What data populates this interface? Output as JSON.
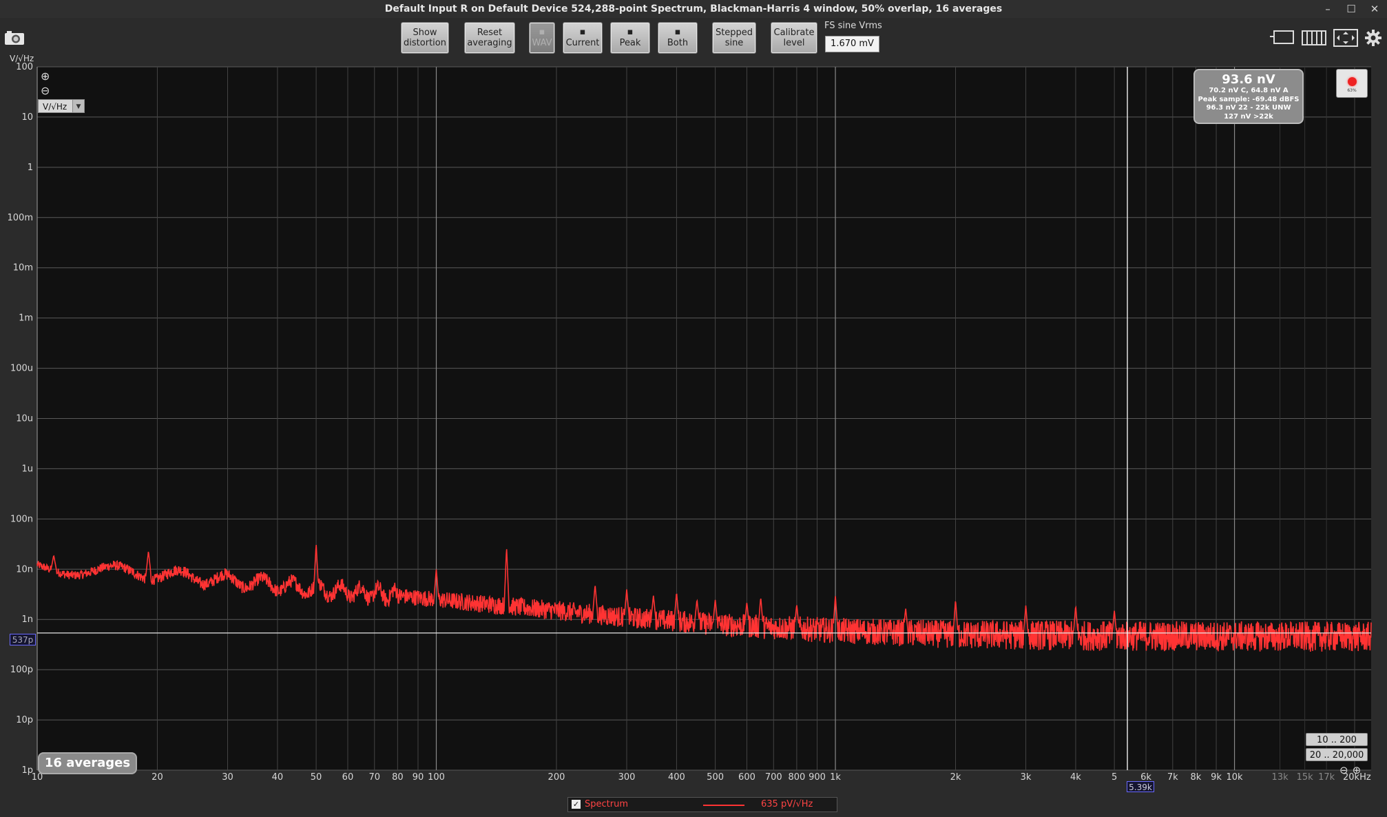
{
  "window": {
    "title": "Default Input R on Default Device 524,288-point Spectrum, Blackman-Harris 4 window, 50% overlap, 16 averages",
    "minimize": "–",
    "maximize": "☐",
    "close": "✕"
  },
  "toolbar": {
    "show_distortion": [
      "Show",
      "distortion"
    ],
    "reset_averaging": [
      "Reset",
      "averaging"
    ],
    "wav": "WAV",
    "current": "Current",
    "peak": "Peak",
    "both": "Both",
    "stepped_sine": [
      "Stepped",
      "sine"
    ],
    "calibrate_level": [
      "Calibrate",
      "level"
    ],
    "fs_label": "FS sine Vrms",
    "fs_value": "1.670 mV"
  },
  "plot": {
    "unit_label": "V/√Hz",
    "unit_select": "V/√Hz",
    "readout": {
      "main": "93.6 nV",
      "line1": "70.2 nV C, 64.8 nV A",
      "line2": "Peak sample: -69.48 dBFS",
      "line3": "96.3 nV 22 - 22k UNW",
      "line4": "127 nV >22k"
    },
    "record_pct": "63%",
    "averages_badge": "16 averages",
    "range_low": "10 .. 200",
    "range_full": "20 .. 20,000",
    "cursor_y": "537p",
    "cursor_x": "5.39k",
    "legend": {
      "name": "Spectrum",
      "value": "635 pV/√Hz",
      "color": "#ff3333"
    }
  },
  "chart_data": {
    "type": "line",
    "xscale": "log",
    "yscale": "log",
    "xlim": [
      10,
      22000
    ],
    "ylim": [
      1e-12,
      100
    ],
    "y_ticks": [
      "100",
      "10",
      "1",
      "100m",
      "10m",
      "1m",
      "100u",
      "10u",
      "1u",
      "100n",
      "10n",
      "1n",
      "100p",
      "10p",
      "1p"
    ],
    "x_ticks": [
      {
        "v": 10,
        "l": "10"
      },
      {
        "v": 20,
        "l": "20"
      },
      {
        "v": 30,
        "l": "30"
      },
      {
        "v": 40,
        "l": "40"
      },
      {
        "v": 50,
        "l": "50"
      },
      {
        "v": 60,
        "l": "60"
      },
      {
        "v": 70,
        "l": "70"
      },
      {
        "v": 80,
        "l": "80"
      },
      {
        "v": 90,
        "l": "90"
      },
      {
        "v": 100,
        "l": "100"
      },
      {
        "v": 200,
        "l": "200"
      },
      {
        "v": 300,
        "l": "300"
      },
      {
        "v": 400,
        "l": "400"
      },
      {
        "v": 500,
        "l": "500"
      },
      {
        "v": 600,
        "l": "600"
      },
      {
        "v": 700,
        "l": "700"
      },
      {
        "v": 800,
        "l": "800"
      },
      {
        "v": 900,
        "l": "900"
      },
      {
        "v": 1000,
        "l": "1k"
      },
      {
        "v": 2000,
        "l": "2k"
      },
      {
        "v": 3000,
        "l": "3k"
      },
      {
        "v": 4000,
        "l": "4k"
      },
      {
        "v": 5000,
        "l": "5"
      },
      {
        "v": 6000,
        "l": "6k"
      },
      {
        "v": 7000,
        "l": "7k"
      },
      {
        "v": 8000,
        "l": "8k"
      },
      {
        "v": 9000,
        "l": "9k"
      },
      {
        "v": 10000,
        "l": "10k"
      },
      {
        "v": 13000,
        "l": "13k",
        "dim": true
      },
      {
        "v": 15000,
        "l": "15k",
        "dim": true
      },
      {
        "v": 17000,
        "l": "17k",
        "dim": true
      },
      {
        "v": 20000,
        "l": "20kHz"
      }
    ],
    "series": [
      {
        "name": "Spectrum",
        "color": "#ff3333",
        "baseline": [
          [
            10,
            1.1e-08
          ],
          [
            20,
            8e-09
          ],
          [
            30,
            6e-09
          ],
          [
            50,
            4e-09
          ],
          [
            70,
            3.3e-09
          ],
          [
            100,
            2.5e-09
          ],
          [
            200,
            1.5e-09
          ],
          [
            300,
            1.1e-09
          ],
          [
            500,
            8e-10
          ],
          [
            1000,
            6e-10
          ],
          [
            2000,
            5e-10
          ],
          [
            5000,
            4.7e-10
          ],
          [
            10000,
            4.6e-10
          ],
          [
            22000,
            4.5e-10
          ]
        ],
        "peaks": [
          [
            11,
            1.9e-08
          ],
          [
            19,
            2.3e-08
          ],
          [
            50,
            3.2e-08
          ],
          [
            100,
            1e-08
          ],
          [
            150,
            2.8e-08
          ],
          [
            250,
            5e-09
          ],
          [
            300,
            4e-09
          ],
          [
            350,
            3e-09
          ],
          [
            400,
            3.5e-09
          ],
          [
            450,
            2.5e-09
          ],
          [
            500,
            2.5e-09
          ],
          [
            600,
            2.2e-09
          ],
          [
            650,
            2.8e-09
          ],
          [
            800,
            2e-09
          ],
          [
            1000,
            3e-09
          ],
          [
            1500,
            1.7e-09
          ],
          [
            2000,
            2.5e-09
          ],
          [
            3000,
            1.9e-09
          ],
          [
            4000,
            1.9e-09
          ],
          [
            5000,
            1.5e-09
          ]
        ]
      }
    ],
    "marker_y": 5.37e-10,
    "marker_x": 5390
  }
}
